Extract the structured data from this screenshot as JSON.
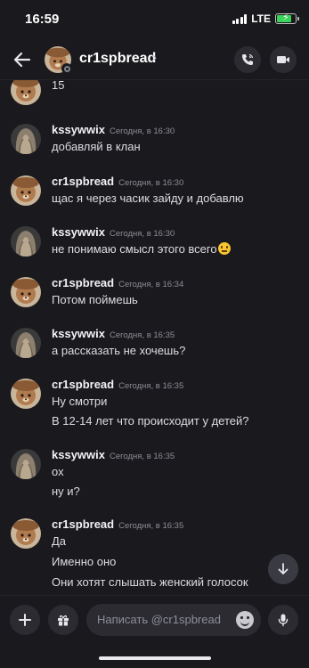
{
  "status_bar": {
    "time": "16:59",
    "network": "LTE",
    "battery_level": 0.8
  },
  "header": {
    "back_icon": "arrow-left-icon",
    "name": "cr1spbread",
    "chevron": "›",
    "call_icon": "phone-call-icon",
    "video_icon": "video-camera-icon"
  },
  "messages": [
    {
      "author": "",
      "time": "",
      "lines": [
        "15"
      ],
      "avatar": "bear"
    },
    {
      "author": "kssywwix",
      "time": "Сегодня, в 16:30",
      "lines": [
        "добавляй в клан"
      ],
      "avatar": "girl"
    },
    {
      "author": "cr1spbread",
      "time": "Сегодня, в 16:30",
      "lines": [
        "щас я через часик зайду и добавлю"
      ],
      "avatar": "bear"
    },
    {
      "author": "kssywwix",
      "time": "Сегодня, в 16:30",
      "lines": [
        "не понимаю смысл этого всего"
      ],
      "avatar": "girl",
      "emoji": "neutral-face-emoji"
    },
    {
      "author": "cr1spbread",
      "time": "Сегодня, в 16:34",
      "lines": [
        "Потом поймешь"
      ],
      "avatar": "bear"
    },
    {
      "author": "kssywwix",
      "time": "Сегодня, в 16:35",
      "lines": [
        "а рассказать не хочешь?"
      ],
      "avatar": "girl"
    },
    {
      "author": "cr1spbread",
      "time": "Сегодня, в 16:35",
      "lines": [
        "Ну смотри",
        "В 12-14 лет что происходит у детей?"
      ],
      "avatar": "bear"
    },
    {
      "author": "kssywwix",
      "time": "Сегодня, в 16:35",
      "lines": [
        "ох",
        "ну и?"
      ],
      "avatar": "girl"
    },
    {
      "author": "cr1spbread",
      "time": "Сегодня, в 16:35",
      "lines": [
        "Да",
        "Именно оно",
        "Они хотят слышать женский голосок"
      ],
      "avatar": "bear"
    }
  ],
  "scroll_button_icon": "arrow-down-icon",
  "input_bar": {
    "add_icon": "plus-icon",
    "gift_icon": "gift-icon",
    "placeholder": "Написать @cr1spbread",
    "emoji_icon": "smile-icon",
    "mic_icon": "microphone-icon"
  },
  "colors": {
    "background": "#1a1a1e",
    "button_bg": "#2b2b31",
    "timestamp": "#8b8b94",
    "battery": "#3bd45a"
  }
}
